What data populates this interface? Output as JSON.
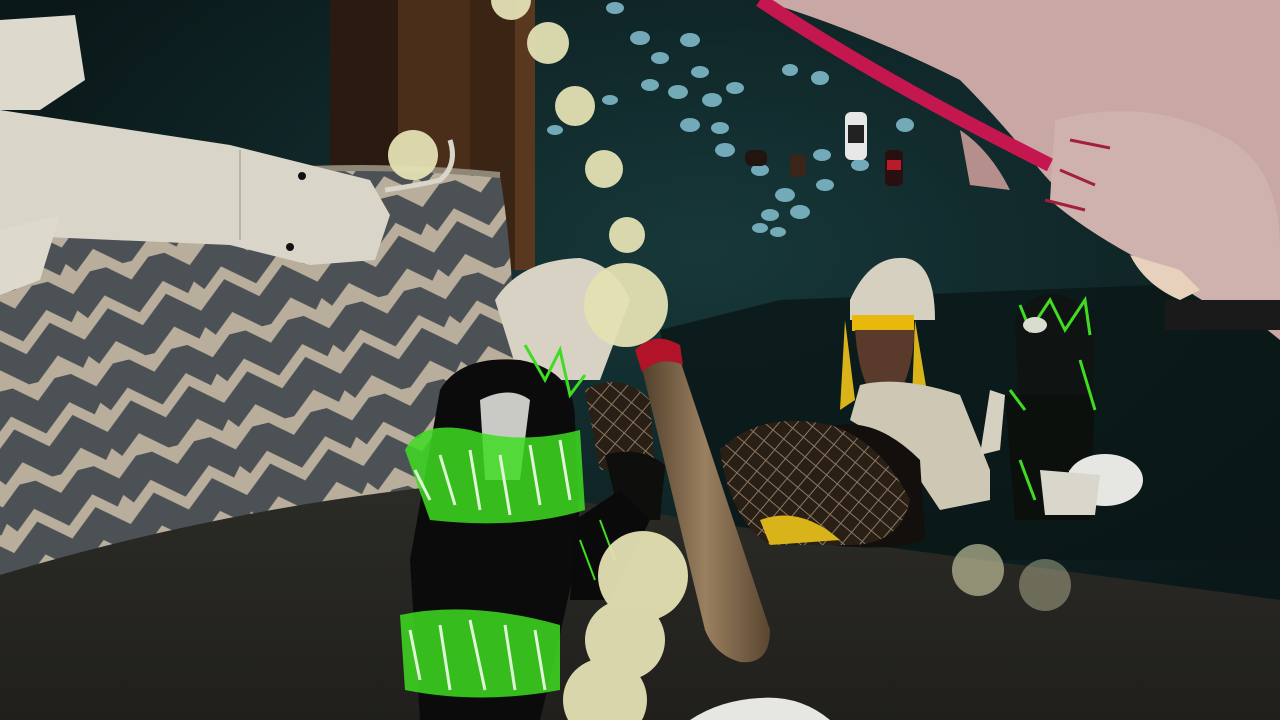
{
  "scene": {
    "kind": "3D social VR game view, first-person",
    "palette": {
      "room_dark": "#0c1d1f",
      "room_teal": "#123436",
      "floor": "#2a2a26",
      "pillow_light": "#bdb3a2",
      "pillow_dark": "#4a4e52",
      "bubble": "#e4e1b4",
      "neon_green": "#3fdc22",
      "gold": "#d8b41a",
      "fish": "#7eb8c8",
      "pink_figure": "#c9a7a4",
      "red_stripe": "#c5174f"
    }
  }
}
